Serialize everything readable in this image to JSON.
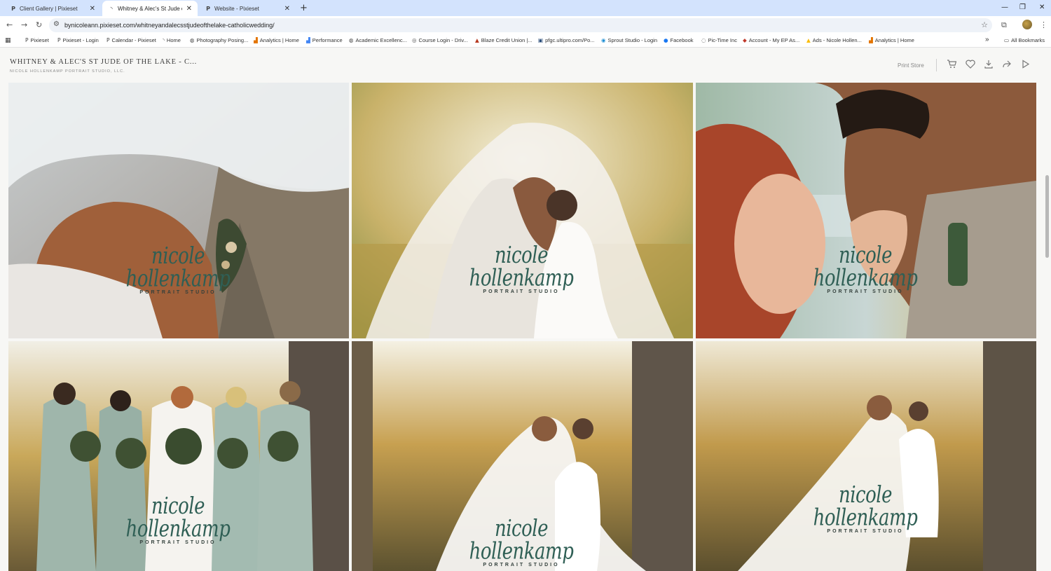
{
  "browser": {
    "tabs": [
      {
        "favicon": "P",
        "title": "Client Gallery | Pixieset"
      },
      {
        "favicon": "loading-icon",
        "title": "Whitney & Alec's St Jude of the"
      },
      {
        "favicon": "P",
        "title": "Website - Pixieset"
      }
    ],
    "new_tab_label": "+",
    "url": "bynicoleann.pixieset.com/whitneyandalecsstjudeofthelake-catholicwedding/",
    "bookmarks": [
      {
        "icon": "P",
        "label": "Pixieset"
      },
      {
        "icon": "P",
        "label": "Pixieset - Login"
      },
      {
        "icon": "P",
        "label": "Calendar - Pixieset"
      },
      {
        "icon": "loading-icon",
        "label": "Home"
      },
      {
        "icon": "globe-icon",
        "label": "Photography Posing..."
      },
      {
        "icon": "analytics-icon",
        "label": "Analytics | Home"
      },
      {
        "icon": "analytics-icon",
        "label": "Performance"
      },
      {
        "icon": "globe-icon",
        "label": "Academic Excellenc..."
      },
      {
        "icon": "course-icon",
        "label": "Course Login - Driv..."
      },
      {
        "icon": "blaze-icon",
        "label": "Blaze Credit Union |..."
      },
      {
        "icon": "ultipro-icon",
        "label": "pfgc.ultipro.com/Po..."
      },
      {
        "icon": "sprout-icon",
        "label": "Sprout Studio - Login"
      },
      {
        "icon": "facebook-icon",
        "label": "Facebook"
      },
      {
        "icon": "pictime-icon",
        "label": "Pic-Time Inc"
      },
      {
        "icon": "ep-icon",
        "label": "Account - My EP As..."
      },
      {
        "icon": "ads-icon",
        "label": "Ads - Nicole Hollen..."
      },
      {
        "icon": "analytics-icon",
        "label": "Analytics | Home"
      }
    ],
    "more_bookmarks": "»",
    "all_bookmarks": "All Bookmarks"
  },
  "gallery": {
    "title": "WHITNEY & ALEC'S ST JUDE OF THE LAKE - C...",
    "subtitle": "NICOLE HOLLENKAMP PORTRAIT STUDIO, LLC.",
    "print_store": "Print Store",
    "watermark": {
      "script": "nicole hollenkamp",
      "sub": "PORTRAIT STUDIO"
    },
    "photos": [
      {
        "alt": "veil over bride and groom close-up"
      },
      {
        "alt": "bride and flower girl under veil"
      },
      {
        "alt": "groom kissing bride's hand"
      },
      {
        "alt": "bride with bridesmaids"
      },
      {
        "alt": "bride and flower girl in field"
      },
      {
        "alt": "bride hugging flower girl"
      }
    ]
  },
  "colors": {
    "tabstrip": "#d3e3fd",
    "watermark": "#2f5f55",
    "header_bg": "#f7f7f5"
  }
}
